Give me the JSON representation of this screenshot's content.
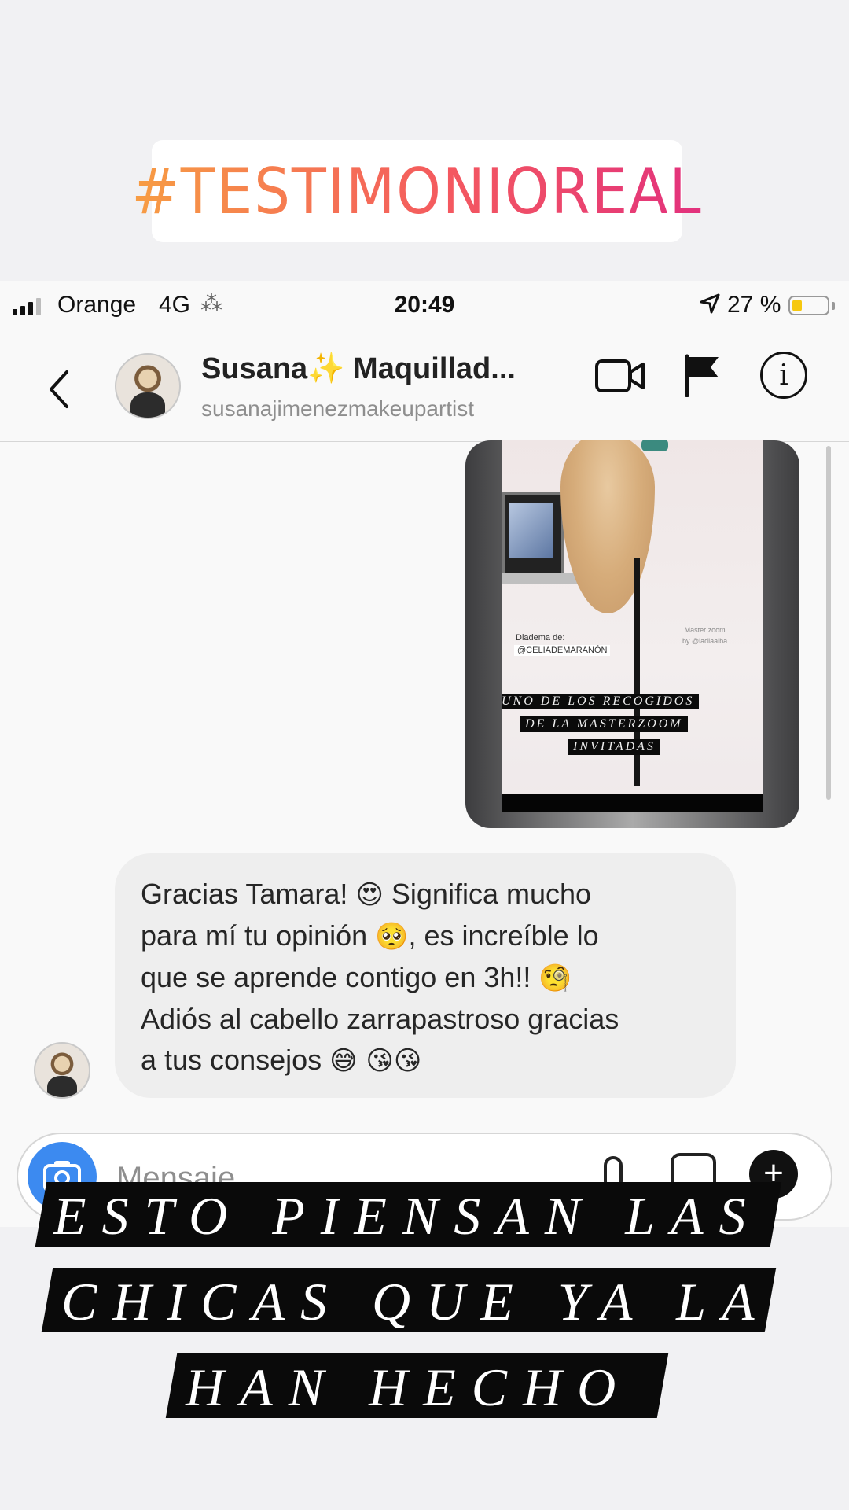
{
  "story": {
    "hashtag": "#TESTIMONIOREAL",
    "caption_lines": [
      "ESTO PIENSAN LAS",
      "CHICAS QUE YA LA",
      "HAN HECHO"
    ]
  },
  "status_bar": {
    "carrier": "Orange",
    "network": "4G",
    "spinner": "⁂",
    "time": "20:49",
    "battery": "27 %",
    "battery_level": 0.27
  },
  "header": {
    "back_icon": "chevron-left-icon",
    "name": "Susana✨ Maquillad...",
    "username": "susanajimenezmakeupartist",
    "actions": [
      "video-call-icon",
      "flag-icon",
      "info-icon"
    ]
  },
  "shared_post": {
    "credit_label": "Diadema de:",
    "credit_tag": "@CELIADEMARANÓN",
    "master_line1": "Master zoom",
    "master_line2": "by @ladiaalba",
    "caption_lines": [
      "UNO DE LOS RECOGIDOS",
      "DE LA MASTERZOOM",
      "INVITADAS"
    ]
  },
  "message": {
    "lines": [
      [
        "Gracias Tamara! ",
        "😍",
        " Significa mucho"
      ],
      [
        "para mí tu opinión ",
        "🥺",
        ", es increíble lo"
      ],
      [
        "que se aprende contigo en 3h!! ",
        "🧐",
        ""
      ],
      [
        "Adiós al cabello zarrapastroso gracias",
        "",
        ""
      ],
      [
        "a tus consejos ",
        "😅 😘😘",
        ""
      ]
    ]
  },
  "composer": {
    "placeholder": "Mensaje...",
    "camera_icon": "camera-icon",
    "mic_icon": "mic-icon",
    "gallery_icon": "gallery-icon",
    "plus_icon": "plus-icon"
  },
  "colors": {
    "hashtag_gradient": [
      "#f79d43",
      "#f4595f",
      "#e2317d"
    ],
    "camera_blue": "#3c8af0",
    "battery_yellow": "#f6c80f"
  }
}
